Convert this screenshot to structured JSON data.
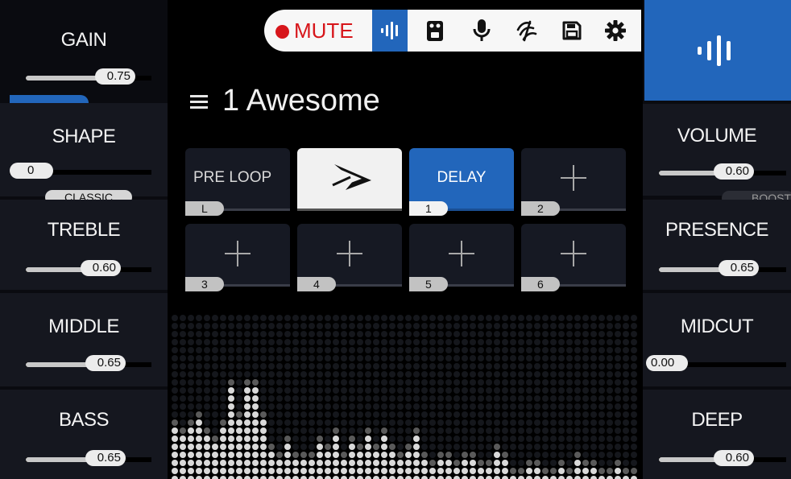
{
  "toolbar": {
    "mute_label": "MUTE",
    "buttons": [
      "waveform-icon",
      "pedal-icon",
      "microphone-icon",
      "tuner-icon",
      "save-icon",
      "settings-icon"
    ],
    "active": "waveform-icon"
  },
  "preset": {
    "name": "1 Awesome"
  },
  "left_controls": [
    {
      "label": "GAIN",
      "value": "0.75",
      "fraction": 0.75
    },
    {
      "label": "SHAPE",
      "value": "0",
      "fraction": 0.0,
      "tag": "CLASSIC"
    },
    {
      "label": "TREBLE",
      "value": "0.60",
      "fraction": 0.6
    },
    {
      "label": "MIDDLE",
      "value": "0.65",
      "fraction": 0.65
    },
    {
      "label": "BASS",
      "value": "0.65",
      "fraction": 0.65
    }
  ],
  "right_controls": [
    {
      "label": "VOLUME",
      "value": "0.60",
      "fraction": 0.6,
      "tag": "BOOST"
    },
    {
      "label": "PRESENCE",
      "value": "0.65",
      "fraction": 0.65
    },
    {
      "label": "MIDCUT",
      "value": "0.00",
      "fraction": 0.0
    },
    {
      "label": "DEEP",
      "value": "0.60",
      "fraction": 0.6
    }
  ],
  "slots": [
    {
      "label": "PRE LOOP",
      "number": "L",
      "kind": "text"
    },
    {
      "label": "",
      "number": "",
      "kind": "logo"
    },
    {
      "label": "DELAY",
      "number": "1",
      "kind": "active"
    },
    {
      "label": "",
      "number": "2",
      "kind": "empty"
    },
    {
      "label": "",
      "number": "3",
      "kind": "empty"
    },
    {
      "label": "",
      "number": "4",
      "kind": "empty"
    },
    {
      "label": "",
      "number": "5",
      "kind": "empty"
    },
    {
      "label": "",
      "number": "6",
      "kind": "empty"
    }
  ],
  "spectrum_levels": [
    7,
    6,
    7,
    8,
    6,
    5,
    7,
    12,
    8,
    12,
    12,
    8,
    4,
    3,
    5,
    3,
    3,
    3,
    5,
    4,
    6,
    3,
    5,
    4,
    6,
    4,
    6,
    4,
    3,
    4,
    6,
    3,
    2,
    3,
    3,
    2,
    3,
    3,
    2,
    2,
    4,
    3,
    1,
    1,
    2,
    2,
    1,
    1,
    2,
    1,
    3,
    2,
    2,
    1,
    1,
    2,
    1,
    1
  ],
  "colors": {
    "accent": "#2266bb",
    "mute": "#d7161b"
  }
}
